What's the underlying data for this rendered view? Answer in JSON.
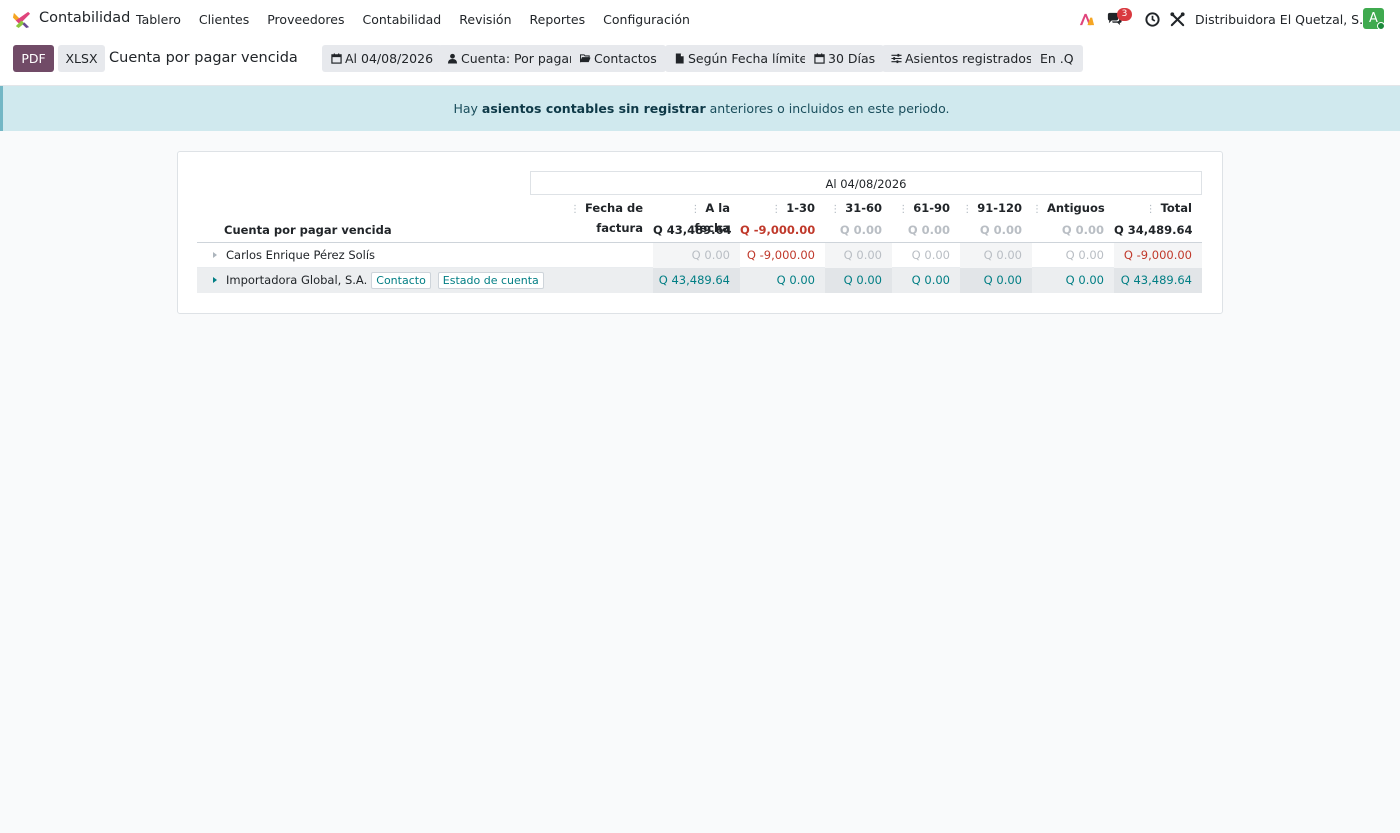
{
  "app": {
    "name": "Contabilidad",
    "menu": [
      "Tablero",
      "Clientes",
      "Proveedores",
      "Contabilidad",
      "Revisión",
      "Reportes",
      "Configuración"
    ],
    "messages_badge": "3",
    "company": "Distribuidora El Quetzal, S.A.",
    "avatar_initial": "A",
    "colors": {
      "brand": "#714b67",
      "link": "#017e84",
      "negative": "#c0392b",
      "avatar": "#3faa4f",
      "badge": "#d9393f"
    }
  },
  "toolbar": {
    "pdf": "PDF",
    "xlsx": "XLSX",
    "title": "Cuenta por pagar vencida",
    "filters": {
      "date": "Al 04/08/2026",
      "account": "Cuenta: Por pagar",
      "partners": "Contactos",
      "basis": "Según Fecha límite",
      "period_length": "30 Días",
      "entries": "Asientos registrados",
      "currency": "En .Q"
    }
  },
  "alert": {
    "pre": "Hay ",
    "link": "asientos contables sin registrar",
    "post": " anteriores o incluidos en este periodo."
  },
  "report": {
    "period": "Al 04/08/2026",
    "columns": [
      "Fecha de factura",
      "A la fecha",
      "1-30",
      "31-60",
      "61-90",
      "91-120",
      "Antiguos",
      "Total"
    ],
    "total_row": {
      "label": "Cuenta por pagar vencida",
      "values": [
        "Q 43,489.64",
        "Q -9,000.00",
        "Q 0.00",
        "Q 0.00",
        "Q 0.00",
        "Q 0.00",
        "Q 34,489.64"
      ]
    },
    "rows": [
      {
        "label": "Carlos Enrique Pérez Solís",
        "values": [
          "Q 0.00",
          "Q -9,000.00",
          "Q 0.00",
          "Q 0.00",
          "Q 0.00",
          "Q 0.00",
          "Q -9,000.00"
        ]
      },
      {
        "label": "Importadora Global, S.A.",
        "contact_btn": "Contacto",
        "statement_btn": "Estado de cuenta",
        "values": [
          "Q 43,489.64",
          "Q 0.00",
          "Q 0.00",
          "Q 0.00",
          "Q 0.00",
          "Q 0.00",
          "Q 43,489.64"
        ]
      }
    ]
  }
}
